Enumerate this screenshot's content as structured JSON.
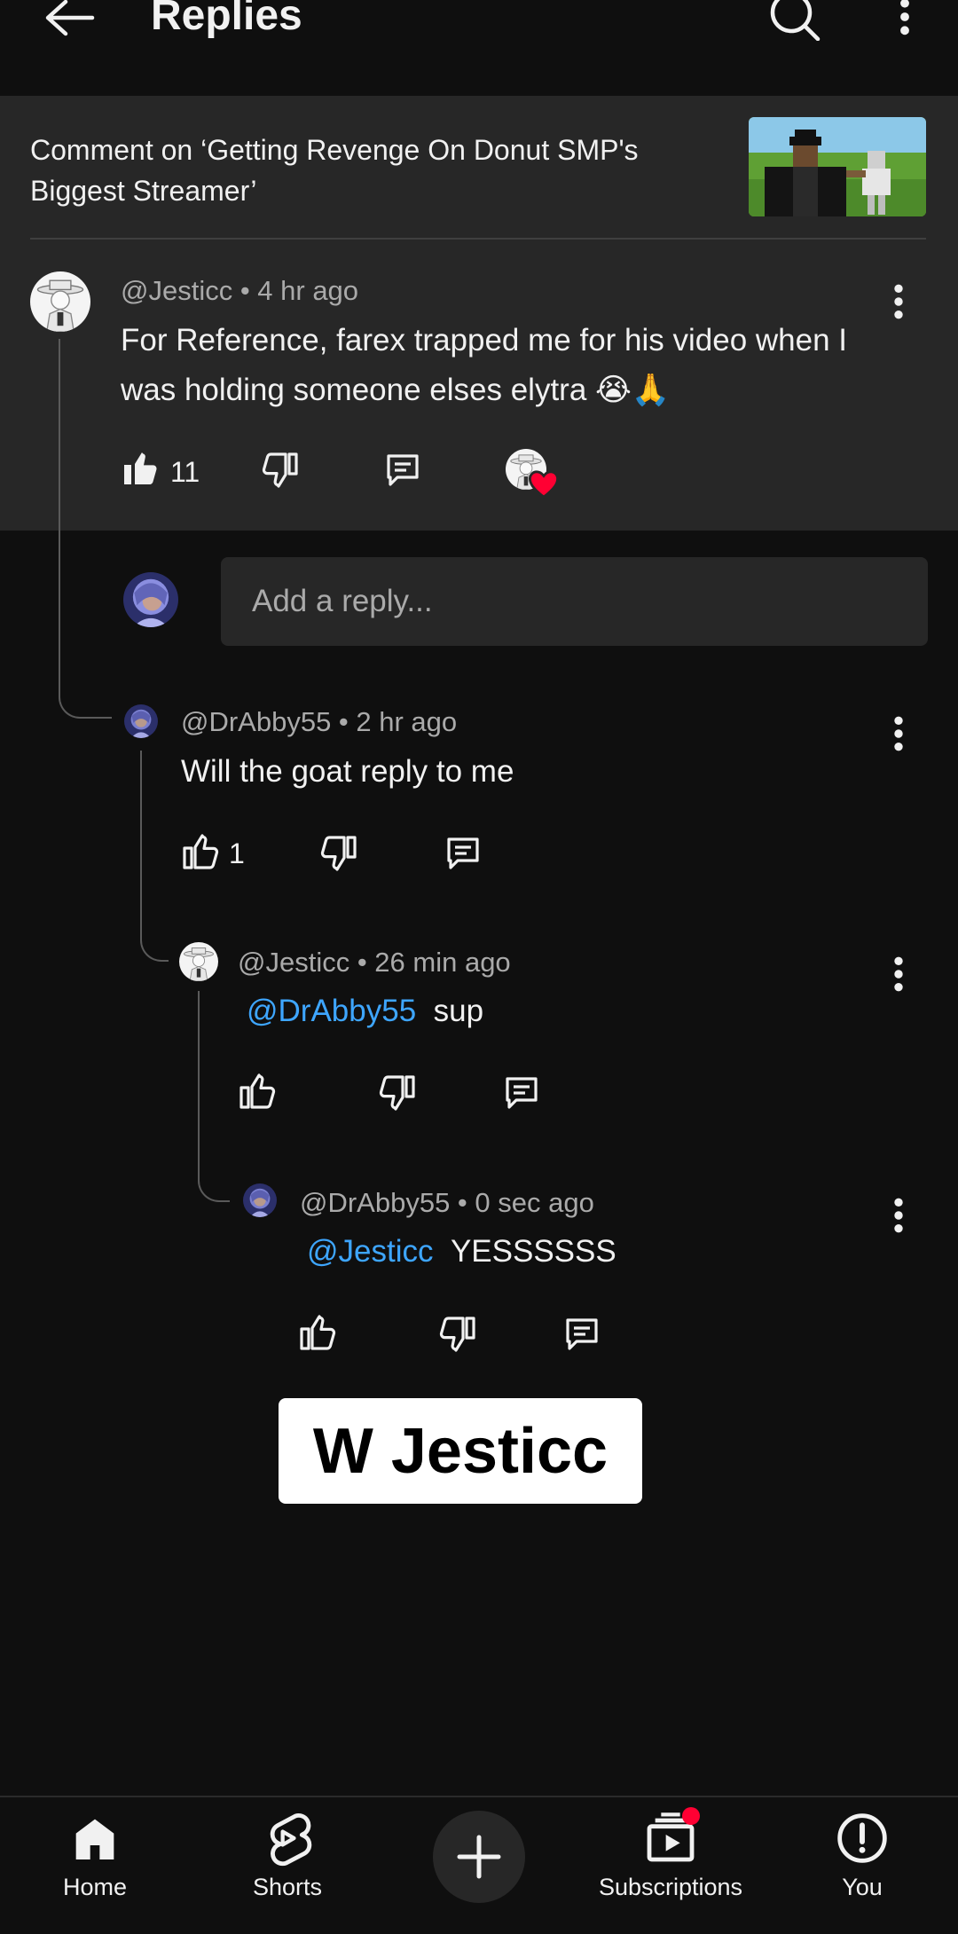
{
  "header": {
    "title": "Replies"
  },
  "context": {
    "text": "Comment on ‘Getting Revenge On Donut SMP's Biggest Streamer’"
  },
  "main_comment": {
    "author_meta": "@Jesticc • 4 hr ago",
    "text": "For Reference, farex trapped me for his video when I was holding someone elses elytra 😭🙏",
    "likes": "11"
  },
  "reply_box": {
    "placeholder": "Add a reply..."
  },
  "replies": [
    {
      "author_meta": "@DrAbby55 • 2 hr ago",
      "mention": "",
      "text": "Will the goat reply to me",
      "likes": "1"
    },
    {
      "author_meta": "@Jesticc • 26 min ago",
      "mention": "@DrAbby55",
      "text": "sup",
      "likes": ""
    },
    {
      "author_meta": "@DrAbby55 • 0 sec ago",
      "mention": "@Jesticc",
      "text": "YESSSSSS",
      "likes": ""
    }
  ],
  "caption": "W Jesticc",
  "nav": {
    "home": "Home",
    "shorts": "Shorts",
    "subscriptions": "Subscriptions",
    "you": "You"
  },
  "colors": {
    "background": "#0f0f0f",
    "panel": "#272727",
    "mention": "#3ea6ff",
    "heart": "#ff0033"
  }
}
